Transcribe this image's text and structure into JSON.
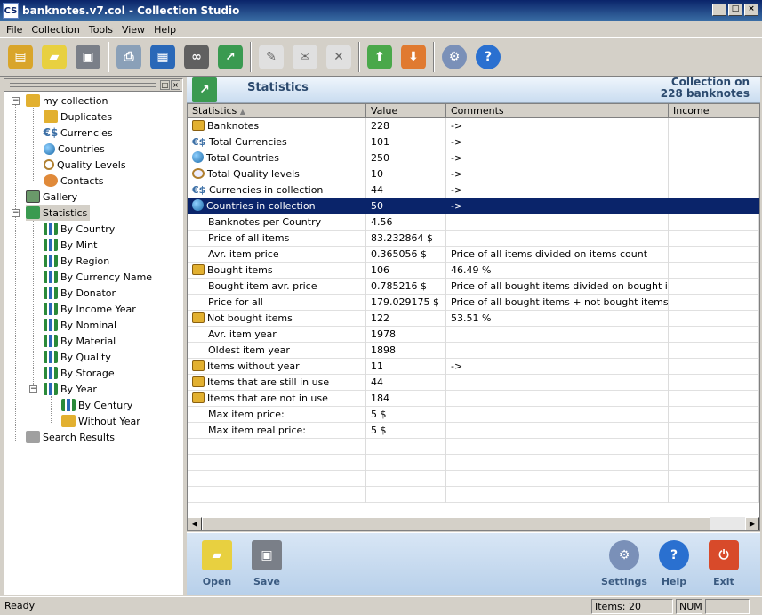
{
  "window": {
    "title": "banknotes.v7.col - Collection Studio",
    "app_icon": "CS",
    "min": "_",
    "max": "□",
    "close": "×"
  },
  "menu": [
    "File",
    "Collection",
    "Tools",
    "View",
    "Help"
  ],
  "tree": {
    "root": "my collection",
    "children": [
      "Duplicates",
      "Currencies",
      "Countries",
      "Quality Levels",
      "Contacts"
    ],
    "gallery": "Gallery",
    "statistics": "Statistics",
    "stats_children": [
      "By Country",
      "By Mint",
      "By Region",
      "By Currency Name",
      "By Donator",
      "By Income Year",
      "By Nominal",
      "By Material",
      "By Quality",
      "By Storage",
      "By Year"
    ],
    "year_children": [
      "By Century",
      "Without Year"
    ],
    "search": "Search Results"
  },
  "header": {
    "title": "Statistics",
    "summary_line1": "Collection on",
    "summary_line2": "228 banknotes"
  },
  "grid": {
    "columns": [
      "Statistics",
      "Value",
      "Comments",
      "Income"
    ],
    "sort_indicator": "▲",
    "rows": [
      {
        "icon": "book",
        "label": "Banknotes",
        "value": "228",
        "comment": "->"
      },
      {
        "icon": "cur",
        "label": "Total Currencies",
        "value": "101",
        "comment": "->"
      },
      {
        "icon": "glob",
        "label": "Total Countries",
        "value": "250",
        "comment": "->"
      },
      {
        "icon": "mag",
        "label": "Total Quality levels",
        "value": "10",
        "comment": "->"
      },
      {
        "icon": "cur",
        "label": "Currencies in collection",
        "value": "44",
        "comment": "->"
      },
      {
        "icon": "glob",
        "label": "Countries in collection",
        "value": "50",
        "comment": "->",
        "selected": true
      },
      {
        "icon": "",
        "label": "Banknotes per Country",
        "value": "4.56",
        "comment": ""
      },
      {
        "icon": "",
        "label": "Price of all items",
        "value": "83.232864 $",
        "comment": ""
      },
      {
        "icon": "",
        "label": "Avr. item price",
        "value": "0.365056 $",
        "comment": "Price of all items divided on items count"
      },
      {
        "icon": "book",
        "label": "Bought items",
        "value": "106",
        "comment": "46.49 %"
      },
      {
        "icon": "",
        "label": "Bought item avr. price",
        "value": "0.785216 $",
        "comment": "Price of all bought items divided on bought items..."
      },
      {
        "icon": "",
        "label": "Price for all",
        "value": "179.029175 $",
        "comment": "Price of all bought items + not bought items * avr..."
      },
      {
        "icon": "book",
        "label": "Not bought items",
        "value": "122",
        "comment": "53.51 %"
      },
      {
        "icon": "",
        "label": "Avr. item year",
        "value": "1978",
        "comment": ""
      },
      {
        "icon": "",
        "label": "Oldest item year",
        "value": "1898",
        "comment": ""
      },
      {
        "icon": "book",
        "label": "Items without year",
        "value": "11",
        "comment": "->"
      },
      {
        "icon": "book",
        "label": "Items that are still in use",
        "value": "44",
        "comment": ""
      },
      {
        "icon": "book",
        "label": "Items that are not in use",
        "value": "184",
        "comment": ""
      },
      {
        "icon": "",
        "label": "Max item price:",
        "value": "5 $",
        "comment": ""
      },
      {
        "icon": "",
        "label": "Max item real price:",
        "value": "5 $",
        "comment": ""
      }
    ]
  },
  "bottom": {
    "open": "Open",
    "save": "Save",
    "settings": "Settings",
    "help": "Help",
    "exit": "Exit"
  },
  "status": {
    "left": "Ready",
    "items": "Items: 20",
    "num": "NUM"
  },
  "colors": {
    "selection": "#0a246a",
    "title_bar": "#0a246a",
    "header_text": "#2c4a6e"
  }
}
